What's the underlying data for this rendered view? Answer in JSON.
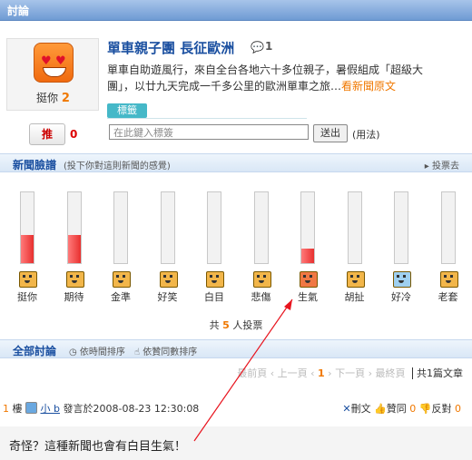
{
  "header": {
    "title": "討論"
  },
  "article": {
    "like_label": "挺你",
    "like_count": "2",
    "title": "單車親子團 長征歐洲",
    "comment_count": "1",
    "summary": "單車自助遊風行，來自全台各地六十多位親子，暑假組成「超級大團」，以廿九天完成一千多公里的歐洲單車之旅…",
    "more_link": "看新聞原文"
  },
  "tags": {
    "label": "標籤",
    "push_label": "推",
    "push_count": "0",
    "input_placeholder": "在此鍵入標簽",
    "send_label": "送出",
    "usage_label": "(用法)"
  },
  "mood": {
    "title": "新聞臉譜",
    "subtitle": "(投下你對這則新聞的感覺)",
    "vote_link": "投票去",
    "items": [
      {
        "label": "挺你",
        "level": 0.4,
        "color": "#f2b64a"
      },
      {
        "label": "期待",
        "level": 0.4,
        "color": "#f2b64a"
      },
      {
        "label": "金準",
        "level": 0,
        "color": "#f2b64a"
      },
      {
        "label": "好笑",
        "level": 0,
        "color": "#f2b64a"
      },
      {
        "label": "白目",
        "level": 0,
        "color": "#f2b64a"
      },
      {
        "label": "悲傷",
        "level": 0,
        "color": "#f2b64a"
      },
      {
        "label": "生氣",
        "level": 0.2,
        "color": "#f07844"
      },
      {
        "label": "胡扯",
        "level": 0,
        "color": "#f2b64a"
      },
      {
        "label": "好冷",
        "level": 0,
        "color": "#9fd0f0"
      },
      {
        "label": "老套",
        "level": 0,
        "color": "#f2b64a"
      }
    ],
    "total_prefix": "共",
    "total_count": "5",
    "total_suffix": "人投票"
  },
  "discussion": {
    "title": "全部討論",
    "sort_time": "依時間排序",
    "sort_votes": "依贊同數排序",
    "pager": {
      "first": "最前頁",
      "prev": "上一頁",
      "current": "1",
      "next": "下一頁",
      "last": "最終頁",
      "total": "共1篇文章"
    },
    "post": {
      "floor": "1",
      "floor_suffix": "樓",
      "user": "小 b",
      "posted": "發言於2008-08-23 12:30:08",
      "delete_label": "刪文",
      "agree_label": "贊同",
      "agree_count": "0",
      "oppose_label": "反對",
      "oppose_count": "0",
      "body": "奇怪？這種新聞也會有白目生氣！"
    }
  },
  "annotation": {
    "arrow_color": "#e8141e"
  }
}
